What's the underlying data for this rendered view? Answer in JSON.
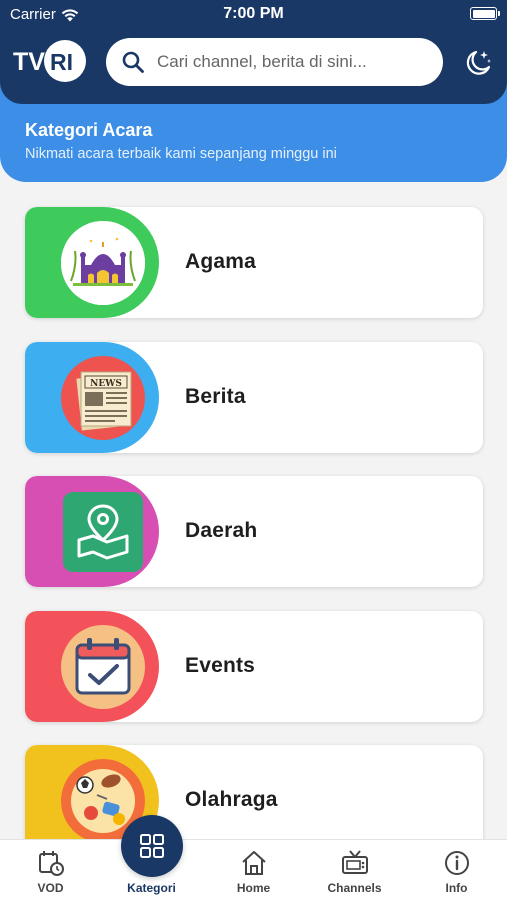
{
  "status_bar": {
    "carrier": "Carrier",
    "time": "7:00 PM"
  },
  "header": {
    "logo_text_1": "TV",
    "logo_text_2": "RI",
    "search_placeholder": "Cari channel, berita di sini...",
    "theme_icon": "moon-stars-icon"
  },
  "section": {
    "title": "Kategori Acara",
    "subtitle": "Nikmati acara terbaik kami sepanjang minggu ini"
  },
  "categories": [
    {
      "label": "Agama",
      "color": "#3fcb5c",
      "icon": "mosque-icon"
    },
    {
      "label": "Berita",
      "color": "#3daef0",
      "icon": "newspaper-icon"
    },
    {
      "label": "Daerah",
      "color": "#d84fb3",
      "icon": "map-pin-icon"
    },
    {
      "label": "Events",
      "color": "#f4525a",
      "icon": "calendar-check-icon"
    },
    {
      "label": "Olahraga",
      "color": "#f1c21e",
      "icon": "sports-icon"
    }
  ],
  "bottom_nav": [
    {
      "label": "VOD",
      "icon": "vod-clock-icon"
    },
    {
      "label": "Kategori",
      "icon": "grid-icon"
    },
    {
      "label": "Home",
      "icon": "home-icon"
    },
    {
      "label": "Channels",
      "icon": "tv-icon"
    },
    {
      "label": "Info",
      "icon": "info-icon"
    }
  ],
  "colors": {
    "navy": "#1a3865",
    "blue": "#3d8ee6"
  }
}
